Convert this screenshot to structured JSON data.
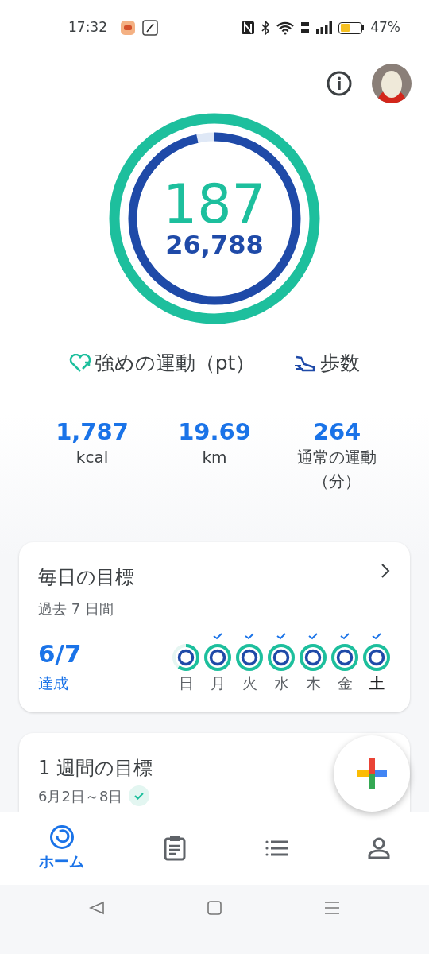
{
  "status_bar": {
    "time": "17:32",
    "battery_text": "47%"
  },
  "rings": {
    "heart": {
      "value": "187",
      "level": 1
    },
    "steps": {
      "value": "26,788",
      "level": 0.965
    }
  },
  "legend": [
    {
      "kind": "heart",
      "label": "強めの運動（pt）"
    },
    {
      "kind": "steps",
      "label": "歩数"
    }
  ],
  "stats": [
    {
      "value": "1,787",
      "label": "kcal"
    },
    {
      "value": "19.69",
      "label": "km"
    },
    {
      "value": "264",
      "label": "通常の運動（分）"
    }
  ],
  "daily_goal": {
    "title": "毎日の目標",
    "subtitle": "過去 7 日間",
    "count": "6/7",
    "count_label": "達成",
    "days": [
      {
        "label": "日",
        "achieved": false,
        "today": false
      },
      {
        "label": "月",
        "achieved": true,
        "today": false
      },
      {
        "label": "火",
        "achieved": true,
        "today": false
      },
      {
        "label": "水",
        "achieved": true,
        "today": false
      },
      {
        "label": "木",
        "achieved": true,
        "today": false
      },
      {
        "label": "金",
        "achieved": true,
        "today": false
      },
      {
        "label": "土",
        "achieved": true,
        "today": true
      }
    ]
  },
  "weekly_goal": {
    "title": "1 週間の目標",
    "subtitle": "6月2日～8日",
    "achieved": true
  },
  "bottom_nav": [
    {
      "kind": "home",
      "label": "ホーム",
      "selected": true
    },
    {
      "kind": "journal",
      "selected": false
    },
    {
      "kind": "browse",
      "selected": false
    },
    {
      "kind": "profile",
      "selected": false
    }
  ]
}
